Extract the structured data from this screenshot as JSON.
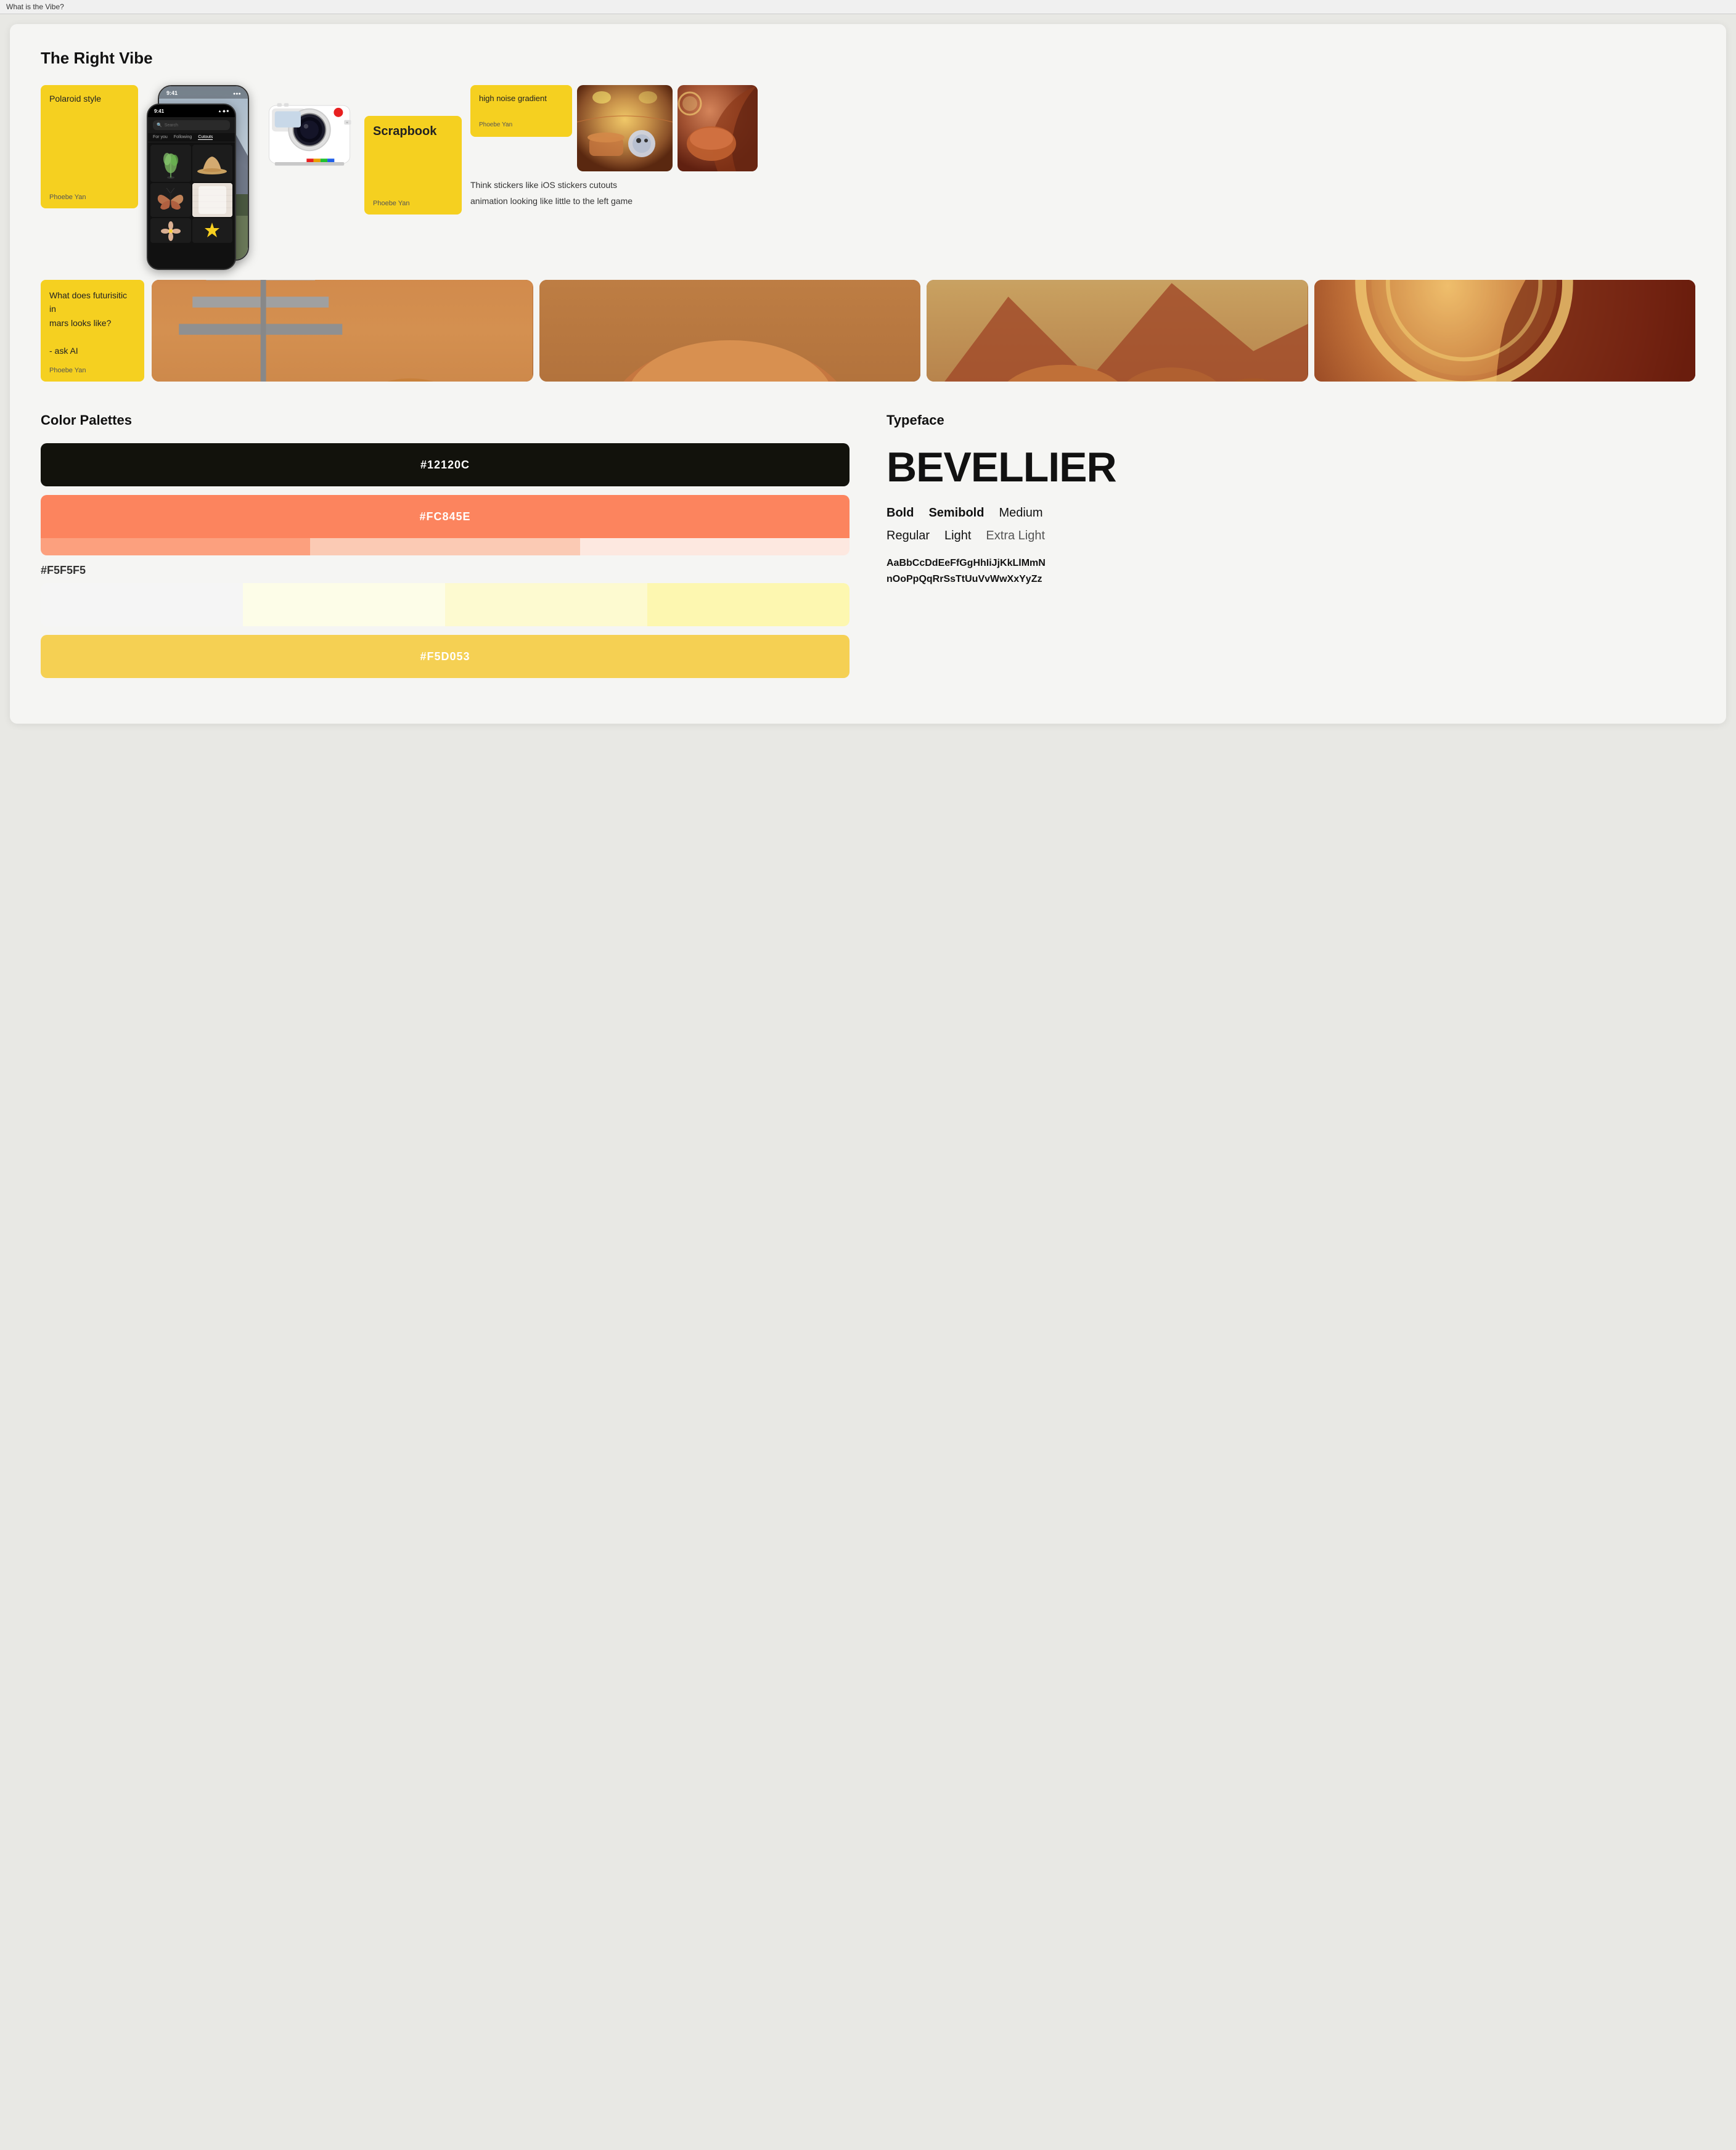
{
  "topbar": {
    "label": "What is the Vibe?"
  },
  "section1": {
    "title": "The Right Vibe",
    "card1": {
      "label": "Polaroid style",
      "author": "Phoebe Yan"
    },
    "phone": {
      "time": "9:41",
      "tabs": [
        "For you",
        "Following",
        "Cutouts"
      ]
    },
    "card2": {
      "label": "Scrapbook",
      "author": "Phoebe Yan"
    },
    "highNoise": {
      "label": "high noise gradient",
      "author": "Phoebe Yan"
    },
    "thinkText1": "Think stickers like iOS stickers cutouts",
    "thinkText2": "animation looking like little to the left game",
    "askAI": {
      "text": "What does futurisitic in mars looks like?\n\n- ask AI",
      "author": "Phoebe Yan"
    }
  },
  "colorPalettes": {
    "title": "Color Palettes",
    "swatches": [
      {
        "hex": "#12120C",
        "label": "#12120C",
        "textColor": "#ffffff"
      },
      {
        "hex": "#FC845E",
        "label": "#FC845E",
        "textColor": "#ffffff"
      },
      {
        "hex": "#F5F5F5",
        "label": "#F5F5F5",
        "textColor": "#333333"
      },
      {
        "hex": "#F5D053",
        "label": "#F5D053",
        "textColor": "#ffffff"
      }
    ]
  },
  "typeface": {
    "title": "Typeface",
    "displayName": "BEVELLIER",
    "weights": [
      "Bold",
      "Semibold",
      "Medium"
    ],
    "weights2": [
      "Regular",
      "Light",
      "Extra Light"
    ],
    "alphabet": "AaBbCcDdEeFfGgHhIiJjKkLlMmN nOoPpQqRrSsTtUuVvWwXxYyZz"
  }
}
